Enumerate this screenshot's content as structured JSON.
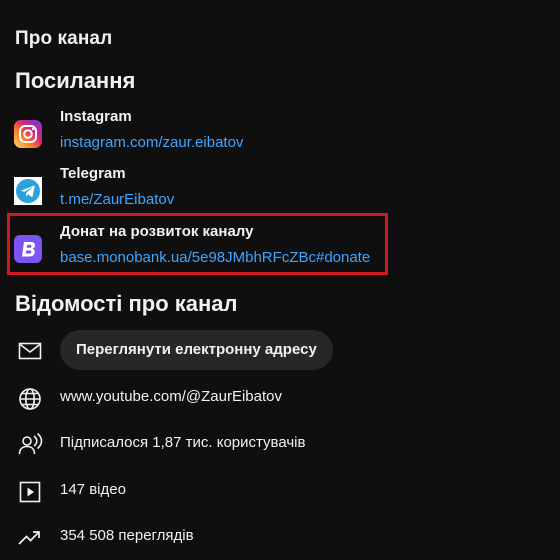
{
  "about_title": "Про канал",
  "links_title": "Посилання",
  "links": [
    {
      "name": "Instagram",
      "url": "instagram.com/zaur.eibatov",
      "icon": "instagram-icon"
    },
    {
      "name": "Telegram",
      "url": "t.me/ZaurEibatov",
      "icon": "telegram-icon"
    },
    {
      "name": "Донат на розвиток каналу",
      "url": "base.monobank.ua/5e98JMbhRFcZBc#donate",
      "icon": "monobank-icon"
    }
  ],
  "details_title": "Відомості про канал",
  "details": {
    "email_button_label": "Переглянути електронну адресу",
    "channel_url": "www.youtube.com/@ZaurEibatov",
    "subscribers": "Підписалося 1,87 тис. користувачів",
    "videos": "147 відео",
    "views": "354 508 переглядів"
  },
  "colors": {
    "background": "#0f0f0f",
    "link": "#3ea6ff",
    "highlight_border": "#d0181e",
    "button_bg": "#272727"
  }
}
